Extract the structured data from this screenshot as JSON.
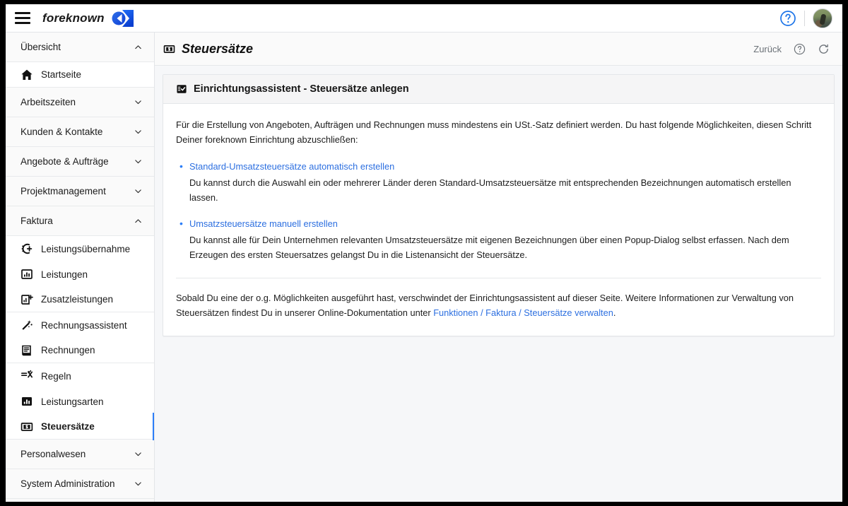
{
  "theme": {
    "accent": "#2c7ef8",
    "link": "#2c6fe0",
    "sidebar_bg": "#fafafa",
    "content_bg": "#f6f7f9"
  },
  "topbar": {
    "menu_icon": "hamburger-icon",
    "brand": "foreknown",
    "logo_icon": "foreknown-logo-icon",
    "help_icon": "help-circle-icon",
    "avatar_icon": "user-avatar"
  },
  "sidebar": {
    "groups": [
      {
        "label": "Übersicht",
        "expanded": true,
        "chevron": "chevron-up-icon"
      },
      {
        "label": "Arbeitszeiten",
        "expanded": false,
        "chevron": "chevron-down-icon"
      },
      {
        "label": "Kunden & Kontakte",
        "expanded": false,
        "chevron": "chevron-down-icon"
      },
      {
        "label": "Angebote & Aufträge",
        "expanded": false,
        "chevron": "chevron-down-icon"
      },
      {
        "label": "Projektmanagement",
        "expanded": false,
        "chevron": "chevron-down-icon"
      },
      {
        "label": "Faktura",
        "expanded": true,
        "chevron": "chevron-up-icon"
      },
      {
        "label": "Personalwesen",
        "expanded": false,
        "chevron": "chevron-down-icon"
      },
      {
        "label": "System Administration",
        "expanded": false,
        "chevron": "chevron-down-icon"
      }
    ],
    "uebersicht_items": [
      {
        "label": "Startseite",
        "icon": "home-icon",
        "active": false
      }
    ],
    "faktura_items": [
      {
        "label": "Leistungsübernahme",
        "icon": "service-transfer-icon",
        "active": false
      },
      {
        "label": "Leistungen",
        "icon": "bar-chart-box-icon",
        "active": false
      },
      {
        "label": "Zusatzleistungen",
        "icon": "bar-chart-plus-icon",
        "active": false
      },
      {
        "label": "Rechnungsassistent",
        "icon": "magic-wand-icon",
        "active": false
      },
      {
        "label": "Rechnungen",
        "icon": "invoice-icon",
        "active": false
      },
      {
        "label": "Regeln",
        "icon": "rules-icon",
        "active": false
      },
      {
        "label": "Leistungsarten",
        "icon": "bar-chart-filled-icon",
        "active": false
      },
      {
        "label": "Steuersätze",
        "icon": "money-note-icon",
        "active": true
      }
    ]
  },
  "page": {
    "title": "Steuersätze",
    "title_icon": "money-note-icon",
    "back_label": "Zurück",
    "help_icon": "help-circle-icon",
    "refresh_icon": "refresh-icon"
  },
  "card": {
    "header_icon": "checklist-icon",
    "header_title": "Einrichtungsassistent - Steuersätze anlegen",
    "lead": "Für die Erstellung von Angeboten, Aufträgen und Rechnungen muss mindestens ein USt.-Satz definiert werden. Du hast folgende Möglichkeiten, diesen Schritt Deiner foreknown Einrichtung abzuschließen:",
    "options": [
      {
        "link": "Standard-Umsatzsteuersätze automatisch erstellen",
        "desc": "Du kannst durch die Auswahl ein oder mehrerer Länder deren Standard-Umsatzsteuersätze mit entsprechenden Bezeichnungen automatisch erstellen lassen."
      },
      {
        "link": "Umsatzsteuersätze manuell erstellen",
        "desc": "Du kannst alle für Dein Unternehmen relevanten Umsatzsteuersätze mit eigenen Bezeichnungen über einen Popup-Dialog selbst erfassen. Nach dem Erzeugen des ersten Steuersatzes gelangst Du in die Listenansicht der Steuersätze."
      }
    ],
    "footnote_before": "Sobald Du eine der o.g. Möglichkeiten ausgeführt hast, verschwindet der Einrichtungsassistent auf dieser Seite. Weitere Informationen zur Verwaltung von Steuersätzen findest Du in unserer Online-Dokumentation unter ",
    "footnote_link": "Funktionen / Faktura / Steuersätze verwalten",
    "footnote_after": "."
  }
}
